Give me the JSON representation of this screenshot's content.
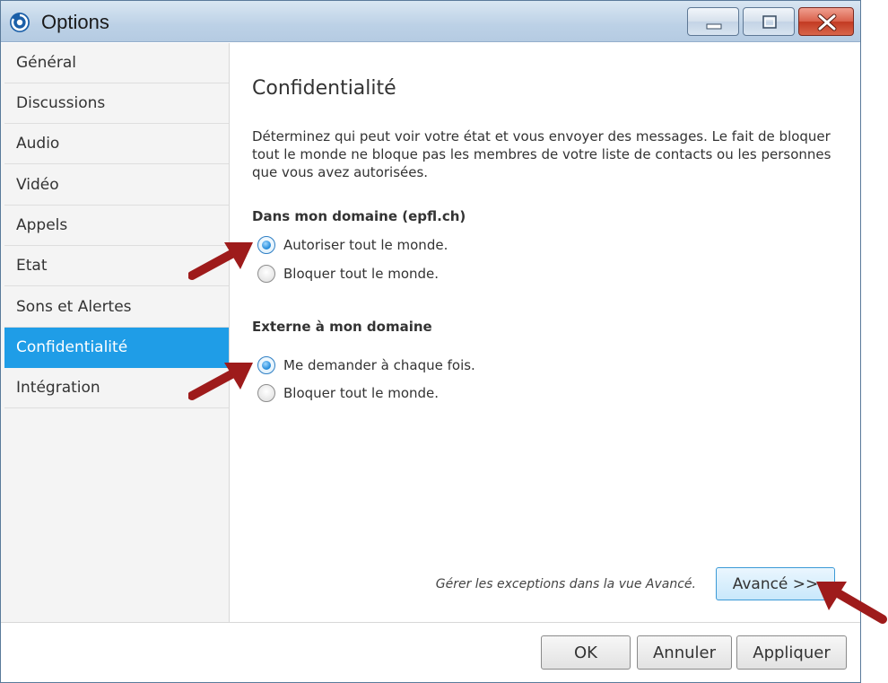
{
  "window": {
    "title": "Options"
  },
  "sidebar": {
    "items": [
      {
        "label": "Général"
      },
      {
        "label": "Discussions"
      },
      {
        "label": "Audio"
      },
      {
        "label": "Vidéo"
      },
      {
        "label": "Appels"
      },
      {
        "label": "Etat"
      },
      {
        "label": "Sons et Alertes"
      },
      {
        "label": "Confidentialité",
        "selected": true
      },
      {
        "label": "Intégration"
      }
    ]
  },
  "content": {
    "title": "Confidentialité",
    "description": "Déterminez qui peut voir votre état et vous envoyer des messages. Le fait de bloquer tout le monde ne bloque pas les membres de votre liste de contacts ou les personnes que vous avez autorisées.",
    "internal": {
      "heading": "Dans mon domaine (epfl.ch)",
      "options": [
        {
          "label": "Autoriser tout le monde.",
          "checked": true
        },
        {
          "label": "Bloquer tout le monde.",
          "checked": false
        }
      ]
    },
    "external": {
      "heading": "Externe à mon domaine",
      "options": [
        {
          "label": "Me demander à chaque fois.",
          "checked": true
        },
        {
          "label": "Bloquer tout le monde.",
          "checked": false
        }
      ]
    },
    "exceptions_note": "Gérer les exceptions dans la vue Avancé.",
    "advanced_label": "Avancé >>"
  },
  "footer": {
    "ok_label": "OK",
    "cancel_label": "Annuler",
    "apply_label": "Appliquer"
  },
  "colors": {
    "selection": "#1f9de7",
    "annotation_arrow": "#9e1b1b"
  },
  "icons": {
    "app": "lync-logo-icon",
    "minimize": "minimize-icon",
    "maximize": "maximize-icon",
    "close": "close-icon"
  }
}
